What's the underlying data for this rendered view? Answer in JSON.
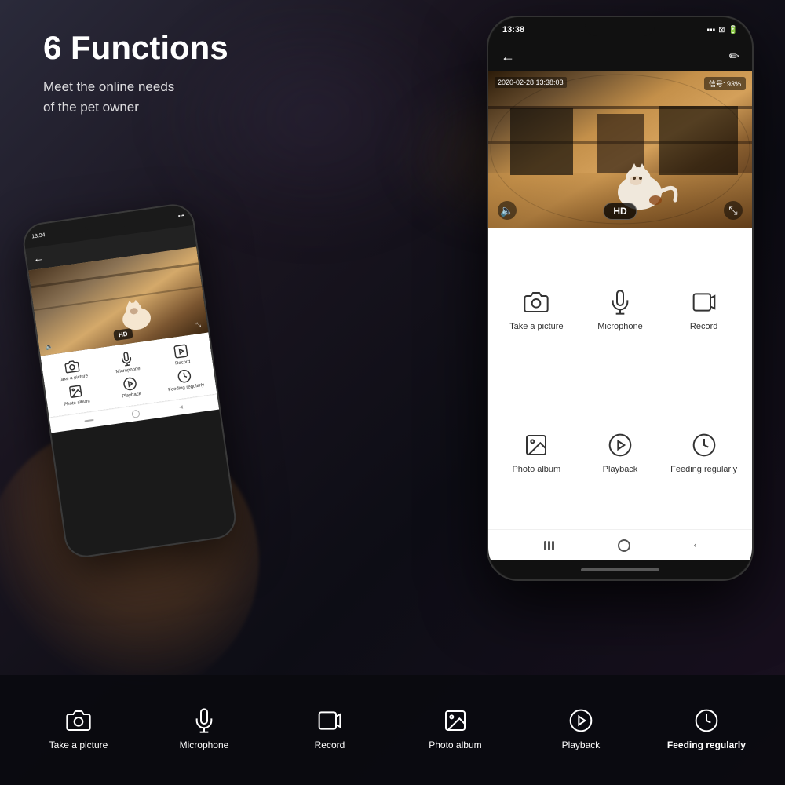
{
  "header": {
    "title": "6 Functions",
    "subtitle_line1": "Meet the online needs",
    "subtitle_line2": "of the pet owner"
  },
  "main_phone": {
    "status_bar": {
      "time": "13:38",
      "signal": "信号: 93%"
    },
    "timestamp": "2020-02-28  13:38:03",
    "hd_label": "HD",
    "functions": [
      {
        "icon": "camera",
        "label": "Take a picture"
      },
      {
        "icon": "microphone",
        "label": "Microphone"
      },
      {
        "icon": "record",
        "label": "Record"
      },
      {
        "icon": "photo-album",
        "label": "Photo album"
      },
      {
        "icon": "playback",
        "label": "Playback"
      },
      {
        "icon": "feeding",
        "label": "Feeding regularly"
      }
    ]
  },
  "bottom_bar": {
    "functions": [
      {
        "icon": "camera",
        "label": "Take a picture",
        "bold": false
      },
      {
        "icon": "microphone",
        "label": "Microphone",
        "bold": false
      },
      {
        "icon": "record",
        "label": "Record",
        "bold": false
      },
      {
        "icon": "photo-album",
        "label": "Photo album",
        "bold": false
      },
      {
        "icon": "playback",
        "label": "Playback",
        "bold": false
      },
      {
        "icon": "feeding",
        "label": "Feeding regularly",
        "bold": true
      }
    ]
  },
  "colors": {
    "background": "#0d0d18",
    "phone_bg": "#111111",
    "app_white": "#ffffff",
    "text_dark": "#333333",
    "text_white": "#ffffff",
    "accent": "#1a1a2e"
  }
}
